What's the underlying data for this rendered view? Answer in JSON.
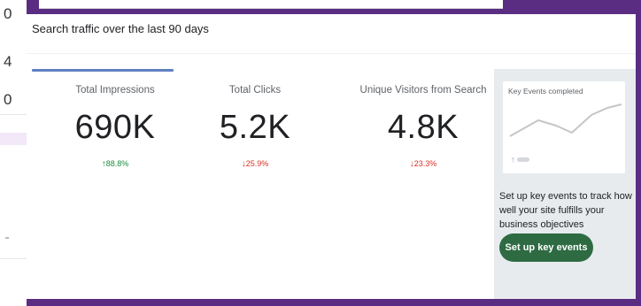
{
  "background_app": {
    "numbers": [
      "0",
      "4",
      "0"
    ]
  },
  "panel": {
    "title": "Search traffic over the last 90 days",
    "metrics": [
      {
        "label": "Total Impressions",
        "value": "690K",
        "change": "88.8%",
        "direction": "up"
      },
      {
        "label": "Total Clicks",
        "value": "5.2K",
        "change": "25.9%",
        "direction": "down"
      },
      {
        "label": "Unique Visitors from Search",
        "value": "4.8K",
        "change": "23.3%",
        "direction": "down"
      }
    ]
  },
  "key_events": {
    "card_title": "Key Events completed",
    "description": "Set up key events to track how well your site fulfills your business objectives",
    "button_label": "Set up key events"
  },
  "colors": {
    "frame": "#5a2d82",
    "up": "#1e8e3e",
    "down": "#d93025",
    "cta": "#2e6b43",
    "tab_indicator": "#5f7fc0"
  },
  "icons": {
    "up_arrow": "arrow-up-icon",
    "down_arrow": "arrow-down-icon"
  }
}
